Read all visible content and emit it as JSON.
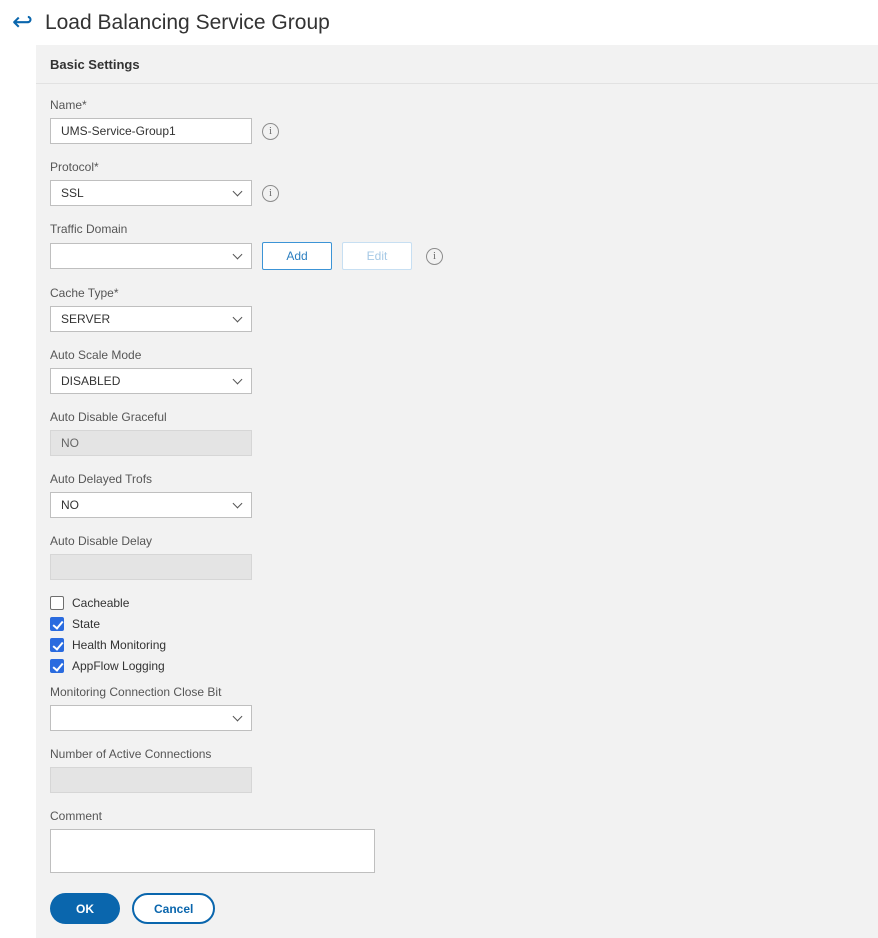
{
  "header": {
    "title": "Load Balancing Service Group"
  },
  "icons": {
    "back": "↩",
    "info": "i"
  },
  "colors": {
    "accent_blue": "#0a66ad",
    "checkbox_blue": "#2a6bdf"
  },
  "panel": {
    "section_title": "Basic Settings",
    "fields": {
      "name": {
        "label": "Name*",
        "value": "UMS-Service-Group1"
      },
      "protocol": {
        "label": "Protocol*",
        "value": "SSL"
      },
      "traffic_domain": {
        "label": "Traffic Domain",
        "value": "",
        "add_label": "Add",
        "edit_label": "Edit"
      },
      "cache_type": {
        "label": "Cache Type*",
        "value": "SERVER"
      },
      "auto_scale_mode": {
        "label": "Auto Scale Mode",
        "value": "DISABLED"
      },
      "auto_disable_graceful": {
        "label": "Auto Disable Graceful",
        "value": "NO"
      },
      "auto_delayed_trofs": {
        "label": "Auto Delayed Trofs",
        "value": "NO"
      },
      "auto_disable_delay": {
        "label": "Auto Disable Delay",
        "value": ""
      },
      "monitoring_connection_close_bit": {
        "label": "Monitoring Connection Close Bit",
        "value": ""
      },
      "number_of_active_connections": {
        "label": "Number of Active Connections",
        "value": ""
      },
      "comment": {
        "label": "Comment",
        "value": ""
      }
    },
    "checkboxes": {
      "cacheable": {
        "label": "Cacheable",
        "checked": false
      },
      "state": {
        "label": "State",
        "checked": true
      },
      "health_monitoring": {
        "label": "Health Monitoring",
        "checked": true
      },
      "appflow_logging": {
        "label": "AppFlow Logging",
        "checked": true
      }
    },
    "buttons": {
      "ok": "OK",
      "cancel": "Cancel"
    }
  }
}
